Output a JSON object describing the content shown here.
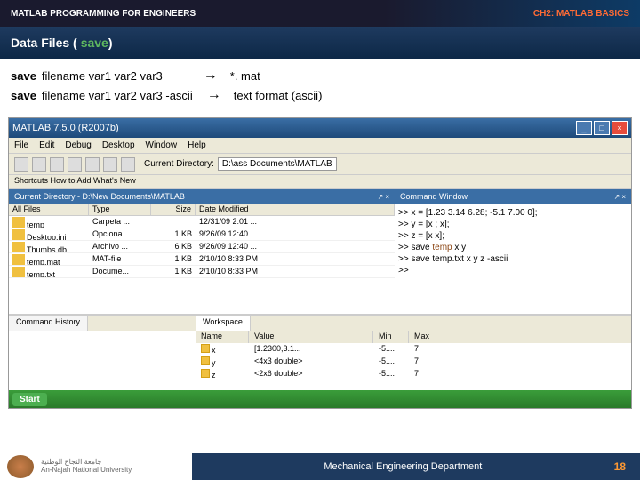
{
  "header": {
    "title": "MATLAB PROGRAMMING FOR ENGINEERS",
    "chapter_prefix": "CH2:",
    "chapter": "MATLAB BASICS"
  },
  "subheader": {
    "title": "Data Files (",
    "highlight": "save",
    "suffix": ")"
  },
  "syntax": {
    "line1_cmd": "save",
    "line1_rest": "filename var1 var2 var3",
    "arrow": "→",
    "line1_result": "*. mat",
    "line2_cmd": "save",
    "line2_rest": "filename var1 var2 var3 -ascii",
    "line2_result": "text format (ascii)"
  },
  "matlab": {
    "title": "MATLAB 7.5.0 (R2007b)",
    "menus": [
      "File",
      "Edit",
      "Debug",
      "Desktop",
      "Window",
      "Help"
    ],
    "shortcuts": "Shortcuts  How to Add  What's New",
    "curdir_label": "Current Directory:",
    "curdir_path": "D:\\ass Documents\\MATLAB",
    "left_panel_title": "Current Directory - D:\\New Documents\\MATLAB",
    "file_cols": {
      "name": "All Files",
      "type": "Type",
      "size": "Size",
      "date": "Date Modified"
    },
    "files": [
      {
        "name": "temp",
        "type": "Carpeta ...",
        "size": "",
        "date": "12/31/09 2:01 ..."
      },
      {
        "name": "Desktop.ini",
        "type": "Opciona...",
        "size": "1 KB",
        "date": "9/26/09 12:40 ..."
      },
      {
        "name": "Thumbs.db",
        "type": "Archivo ...",
        "size": "6 KB",
        "date": "9/26/09 12:40 ..."
      },
      {
        "name": "temp.mat",
        "type": "MAT-file",
        "size": "1 KB",
        "date": "2/10/10 8:33 PM"
      },
      {
        "name": "temp.txt",
        "type": "Docume...",
        "size": "1 KB",
        "date": "2/10/10 8:33 PM"
      }
    ],
    "cmd_title": "Command Window",
    "cmds": [
      ">> x = [1.23 3.14 6.28; -5.1 7.00 0];",
      ">> y = [x ; x];",
      ">> z = [x  x];",
      ">> save temp x y",
      ">> save temp.txt x y z -ascii",
      ">>"
    ],
    "hist_tab": "Command History",
    "work_tab": "Workspace",
    "ws_cols": {
      "name": "Name",
      "val": "Value",
      "min": "Min",
      "max": "Max"
    },
    "vars": [
      {
        "name": "x",
        "val": "[1.2300,3.1...",
        "min": "-5....",
        "max": "7"
      },
      {
        "name": "y",
        "val": "<4x3 double>",
        "min": "-5....",
        "max": "7"
      },
      {
        "name": "z",
        "val": "<2x6 double>",
        "min": "-5....",
        "max": "7"
      }
    ],
    "start": "Start"
  },
  "footer": {
    "uni_ar": "جامعة النجاح الوطنية",
    "uni_en": "An-Najah National University",
    "dept": "Mechanical Engineering Department",
    "page": "18"
  }
}
